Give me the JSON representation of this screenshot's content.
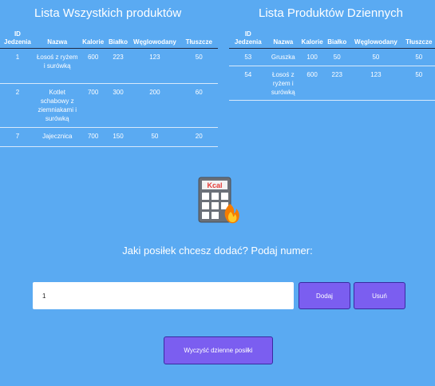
{
  "all_products": {
    "title": "Lista Wszystkich produktów",
    "columns": [
      "ID Jedzenia",
      "Nazwa",
      "Kalorie",
      "Białko",
      "Węglowodany",
      "Tłuszcze"
    ],
    "rows": [
      {
        "id": "1",
        "name": "Łosoś z ryżem i surówką",
        "kalorie": "600",
        "bialko": "223",
        "weglowodany": "123",
        "tluszcze": "50"
      },
      {
        "id": "2",
        "name": "Kotlet schabowy z ziemniakami i surówką",
        "kalorie": "700",
        "bialko": "300",
        "weglowodany": "200",
        "tluszcze": "60"
      },
      {
        "id": "7",
        "name": "Jajecznica",
        "kalorie": "700",
        "bialko": "150",
        "weglowodany": "50",
        "tluszcze": "20"
      }
    ]
  },
  "daily_products": {
    "title": "Lista Produktów Dziennych",
    "columns": [
      "ID Jedzenia",
      "Nazwa",
      "Kalorie",
      "Białko",
      "Węglowodany",
      "Tłuszcze"
    ],
    "rows": [
      {
        "id": "53",
        "name": "Gruszka",
        "kalorie": "100",
        "bialko": "50",
        "weglowodany": "50",
        "tluszcze": "50"
      },
      {
        "id": "54",
        "name": "Łosoś z ryżem i surówką",
        "kalorie": "600",
        "bialko": "223",
        "weglowodany": "123",
        "tluszcze": "50"
      }
    ]
  },
  "icon": {
    "name": "calculator-kcal-icon",
    "label": "Kcal"
  },
  "form": {
    "question": "Jaki posiłek chcesz dodać? Podaj numer:",
    "input_value": "1",
    "add_label": "Dodaj",
    "remove_label": "Usuń",
    "clear_label": "Wyczyść dzienne posiłki"
  },
  "colors": {
    "background": "#5aaaf2",
    "button": "#7b5ef0"
  }
}
